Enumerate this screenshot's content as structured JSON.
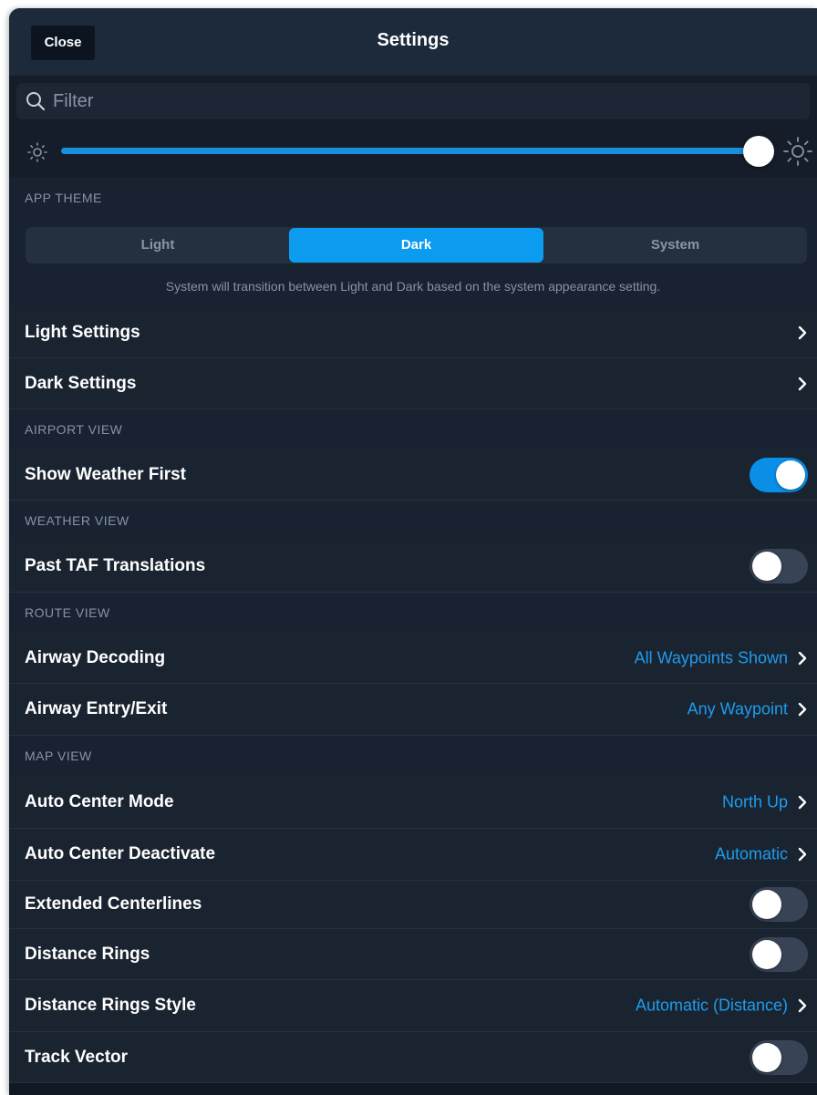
{
  "header": {
    "close_label": "Close",
    "title": "Settings"
  },
  "filter": {
    "placeholder": "Filter",
    "value": ""
  },
  "brightness": {
    "level": 1.0
  },
  "colors": {
    "accent": "#0b9cf0",
    "background": "#101823",
    "value_text": "#1f9bec"
  },
  "app_theme": {
    "header": "APP THEME",
    "options": [
      "Light",
      "Dark",
      "System"
    ],
    "selected": "Dark",
    "note": "System will transition between Light and Dark based on the system appearance setting.",
    "rows": [
      {
        "label": "Light Settings"
      },
      {
        "label": "Dark Settings"
      }
    ]
  },
  "airport_view": {
    "header": "AIRPORT VIEW",
    "rows": [
      {
        "label": "Show Weather First",
        "toggle": true
      }
    ]
  },
  "weather_view": {
    "header": "WEATHER VIEW",
    "rows": [
      {
        "label": "Past TAF Translations",
        "toggle": false
      }
    ]
  },
  "route_view": {
    "header": "ROUTE VIEW",
    "rows": [
      {
        "label": "Airway Decoding",
        "value": "All Waypoints Shown"
      },
      {
        "label": "Airway Entry/Exit",
        "value": "Any Waypoint"
      }
    ]
  },
  "map_view": {
    "header": "MAP VIEW",
    "rows": [
      {
        "label": "Auto Center Mode",
        "value": "North Up"
      },
      {
        "label": "Auto Center Deactivate",
        "value": "Automatic"
      },
      {
        "label": "Extended Centerlines",
        "toggle": false
      },
      {
        "label": "Distance Rings",
        "toggle": false
      },
      {
        "label": "Distance Rings Style",
        "value": "Automatic (Distance)"
      },
      {
        "label": "Track Vector",
        "toggle": false
      }
    ]
  }
}
